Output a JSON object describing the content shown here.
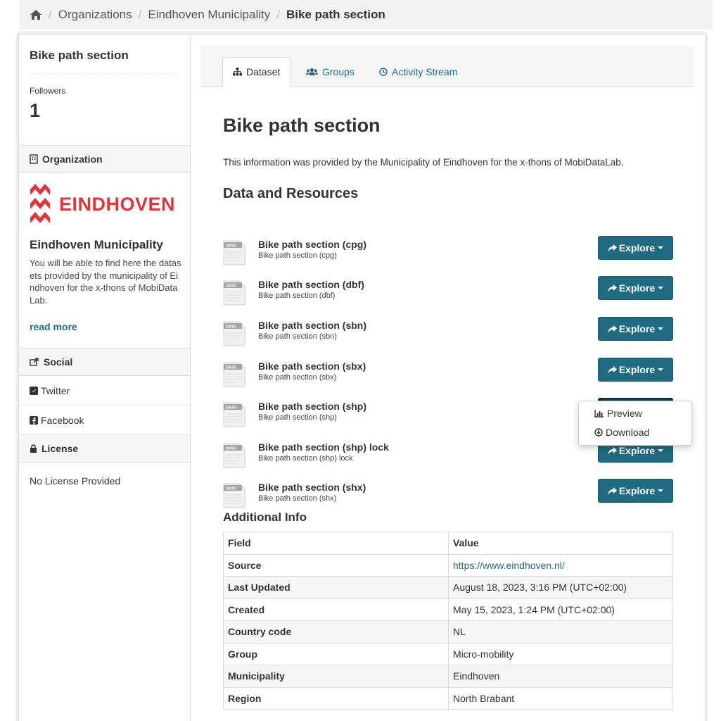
{
  "breadcrumb": {
    "items": [
      "Organizations",
      "Eindhoven Municipality"
    ],
    "current": "Bike path section"
  },
  "sidebar": {
    "title": "Bike path section",
    "followers_label": "Followers",
    "followers_count": "1",
    "organization_heading": "Organization",
    "logo_text": "EINDHOVEN",
    "org_name": "Eindhoven Municipality",
    "org_description": "You will be able to find here the datasets provided by the municipality of Eindhoven for the x-thons of MobiDataLab.",
    "read_more": "read more",
    "social_heading": "Social",
    "social_items": [
      "Twitter",
      "Facebook"
    ],
    "license_heading": "License",
    "license_value": "No License Provided"
  },
  "tabs": [
    {
      "label": "Dataset",
      "active": true
    },
    {
      "label": "Groups",
      "active": false
    },
    {
      "label": "Activity Stream",
      "active": false
    }
  ],
  "dataset": {
    "title": "Bike path section",
    "notes": "This information was provided by the Municipality of Eindhoven for the x-thons of MobiDataLab."
  },
  "resources_heading": "Data and Resources",
  "resources": [
    {
      "name": "Bike path section (cpg)",
      "description": "Bike path section (cpg)",
      "button": "Explore"
    },
    {
      "name": "Bike path section (dbf)",
      "description": "Bike path section (dbf)",
      "button": "Explore"
    },
    {
      "name": "Bike path section (sbn)",
      "description": "Bike path section (sbn)",
      "button": "Explore"
    },
    {
      "name": "Bike path section (sbx)",
      "description": "Bike path section (sbx)",
      "button": "Explore"
    },
    {
      "name": "Bike path section (shp)",
      "description": "Bike path section (shp)",
      "button": "Explore"
    },
    {
      "name": "Bike path section (shp) lock",
      "description": "Bike path section (shp) lock",
      "button": "Explore"
    },
    {
      "name": "Bike path section (shx)",
      "description": "Bike path section (shx)",
      "button": "Explore"
    }
  ],
  "resource_icon_label": "DATA",
  "dropdown": {
    "preview": "Preview",
    "download": "Download"
  },
  "additional_info": {
    "heading": "Additional Info",
    "columns": [
      "Field",
      "Value"
    ],
    "rows": [
      {
        "field": "Source",
        "value": "https://www.eindhoven.nl/"
      },
      {
        "field": "Last Updated",
        "value": "August 18, 2023, 3:16 PM (UTC+02:00)"
      },
      {
        "field": "Created",
        "value": "May 15, 2023, 1:24 PM (UTC+02:00)"
      },
      {
        "field": "Country code",
        "value": "NL"
      },
      {
        "field": "Group",
        "value": "Micro-mobility"
      },
      {
        "field": "Municipality",
        "value": "Eindhoven"
      },
      {
        "field": "Region",
        "value": "North Brabant"
      }
    ]
  },
  "colors": {
    "accent": "#206b82",
    "accent_dark": "#12394a",
    "logo_red": "#e2353b"
  },
  "icons": {
    "home": "home-icon",
    "organization": "building-icon",
    "social": "share-icon",
    "twitter": "twitter-icon",
    "facebook": "facebook-icon",
    "license": "lock-icon",
    "dataset_tab": "sitemap-icon",
    "groups_tab": "users-icon",
    "activity_tab": "clock-icon",
    "explore": "share-arrow-icon",
    "preview": "bar-chart-icon",
    "download": "download-icon"
  }
}
